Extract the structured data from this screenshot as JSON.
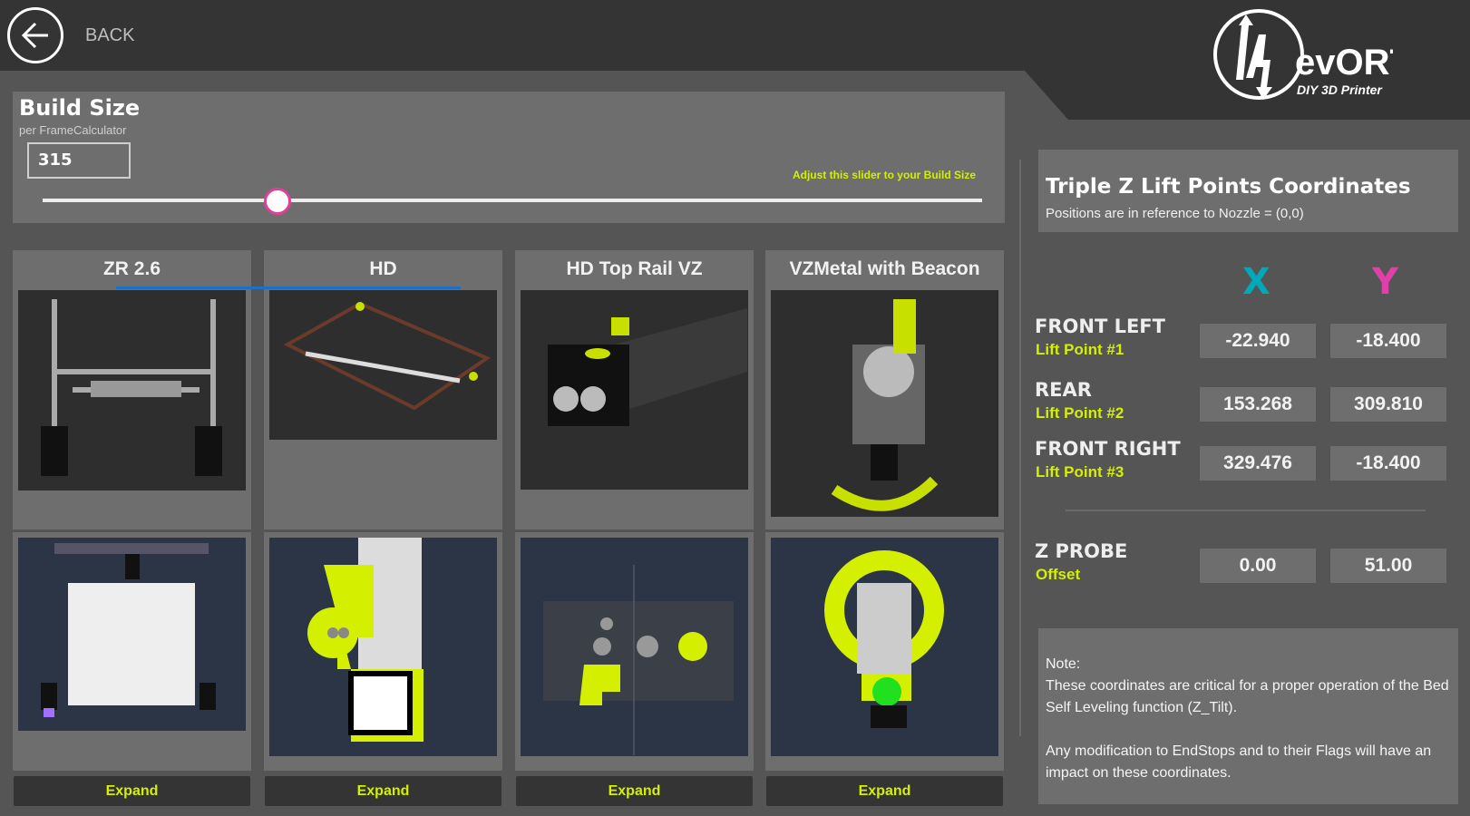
{
  "header": {
    "back_label": "BACK",
    "logo_text": "HevORT",
    "logo_tagline": "DIY 3D Printer"
  },
  "build_size": {
    "title": "Build Size",
    "subtitle": "per FrameCalculator",
    "value": "315",
    "hint": "Adjust this slider to your Build Size",
    "slider_fraction": 0.25
  },
  "printheads": [
    {
      "title": "ZR 2.6",
      "expand": "Expand",
      "selected": true
    },
    {
      "title": "HD",
      "expand": "Expand",
      "selected": true
    },
    {
      "title": "HD Top Rail VZ",
      "expand": "Expand",
      "selected": false
    },
    {
      "title": "VZMetal with Beacon",
      "expand": "Expand",
      "selected": false
    }
  ],
  "coords": {
    "title": "Triple Z Lift Points Coordinates",
    "subtitle": "Positions are in reference to Nozzle = (0,0)",
    "x_label": "X",
    "y_label": "Y",
    "x_color": "#00a8b8",
    "y_color": "#e040a8",
    "rows": [
      {
        "name": "FRONT LEFT",
        "sub": "Lift Point #1",
        "x": "-22.940",
        "y": "-18.400"
      },
      {
        "name": "REAR",
        "sub": "Lift Point #2",
        "x": "153.268",
        "y": "309.810"
      },
      {
        "name": "FRONT RIGHT",
        "sub": "Lift Point #3",
        "x": "329.476",
        "y": "-18.400"
      }
    ],
    "probe": {
      "name": "Z PROBE",
      "sub": "Offset",
      "x": "0.00",
      "y": "51.00"
    }
  },
  "note": {
    "heading": "Note:",
    "p1": "These coordinates are critical for a proper operation of the Bed Self Leveling function (Z_Tilt).",
    "p2": "Any modification to EndStops and to their Flags will have an impact on these coordinates."
  }
}
